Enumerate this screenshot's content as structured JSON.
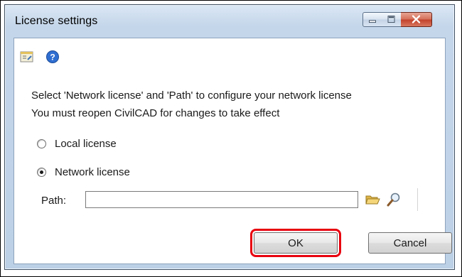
{
  "window": {
    "title": "License settings",
    "controls": [
      "minimize-icon",
      "maximize-icon",
      "close-icon"
    ]
  },
  "toolbar": {
    "icons": [
      "properties-icon",
      "help-icon"
    ]
  },
  "info": {
    "line1": "Select 'Network license' and 'Path' to configure your network license",
    "line2": "You must reopen CivilCAD for changes to take effect"
  },
  "license_options": {
    "local_label": "Local license",
    "network_label": "Network license",
    "selected": "network"
  },
  "path": {
    "label": "Path:",
    "value": ""
  },
  "buttons": {
    "ok_label": "OK",
    "cancel_label": "Cancel"
  },
  "colors": {
    "highlight": "#e8000f",
    "close_button": "#c7442c",
    "frame": "#bcd0e6"
  }
}
